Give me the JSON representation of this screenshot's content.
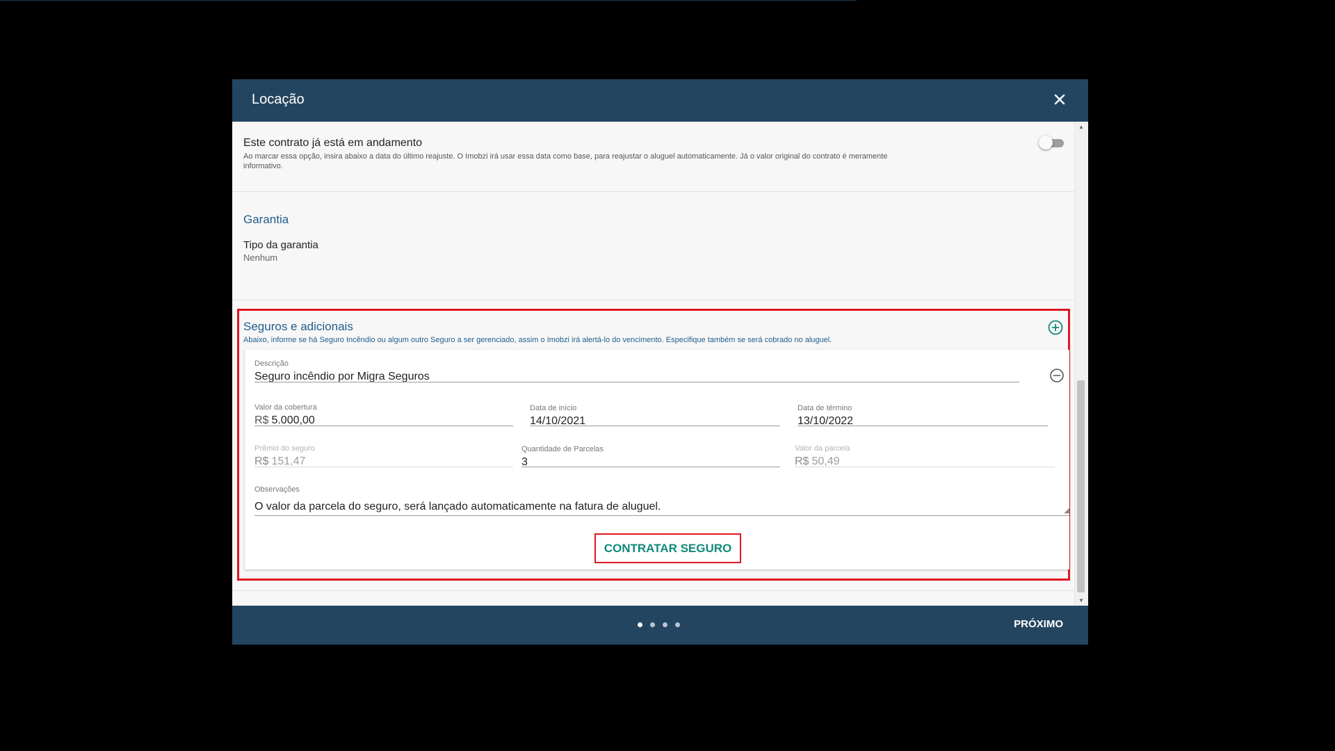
{
  "modal": {
    "title": "Locação",
    "close_icon": "close-icon"
  },
  "contract": {
    "title": "Este contrato já está em andamento",
    "description": "Ao marcar essa opção, insira abaixo a data do último reajuste. O Imobzi irá usar essa data como base, para reajustar o aluguel automaticamente. Já o valor original do contrato é meramente informativo.",
    "toggle_on": false
  },
  "garantia": {
    "title": "Garantia",
    "type_label": "Tipo da garantia",
    "type_value": "Nenhum"
  },
  "seguros": {
    "title": "Seguros e adicionais",
    "description": "Abaixo, informe se há Seguro Incêndio ou algum outro Seguro a ser gerenciado, assim o Imobzi irá alertá-lo do vencimento. Especifique também se será cobrado no aluguel.",
    "add_icon": "plus-circle-icon",
    "item": {
      "remove_icon": "minus-circle-icon",
      "descricao_label": "Descrição",
      "descricao_value": "Seguro incêndio por Migra Seguros",
      "cobertura_label": "Valor da cobertura",
      "cobertura_prefix": "R$",
      "cobertura_value": "5.000,00",
      "inicio_label": "Data de início",
      "inicio_value": "14/10/2021",
      "termino_label": "Data de término",
      "termino_value": "13/10/2022",
      "premio_label": "Prêmio do seguro",
      "premio_prefix": "R$",
      "premio_value": "151,47",
      "parcelas_label": "Quantidade de Parcelas",
      "parcelas_value": "3",
      "valor_parcela_label": "Valor da parcela",
      "valor_parcela_prefix": "R$",
      "valor_parcela_value": "50,49",
      "observacoes_label": "Observações",
      "observacoes_value": "O valor da parcela do seguro, será lançado automaticamente na fatura de aluguel.",
      "contratar_label": "CONTRATAR SEGURO"
    }
  },
  "footer": {
    "pages": 4,
    "active_page": 1,
    "next_label": "PRÓXIMO"
  },
  "colors": {
    "header_bg": "#244560",
    "section_title": "#1f5d8c",
    "accent_teal": "#0f8a78",
    "highlight_red": "#e0161f"
  }
}
